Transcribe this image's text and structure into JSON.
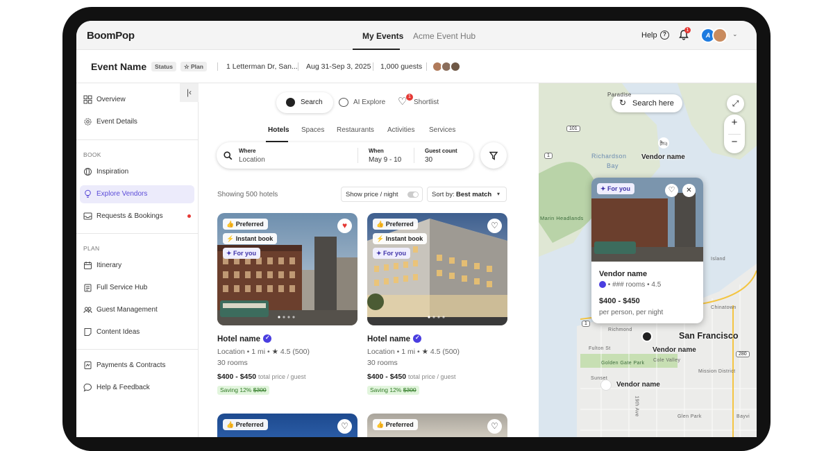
{
  "app": {
    "logo": "BoomPop"
  },
  "topnav": {
    "tabs": [
      {
        "label": "My Events"
      },
      {
        "label": "Acme Event Hub"
      }
    ],
    "help": "Help",
    "notification_count": "1"
  },
  "event": {
    "name": "Event Name",
    "status": "Status",
    "plan": "Plan",
    "address": "1 Letterman Dr, San...",
    "dates": "Aug 31-Sep 3, 2025",
    "guests": "1,000 guests"
  },
  "sidebar": {
    "top_items": [
      {
        "label": "Overview",
        "icon": "grid-icon"
      },
      {
        "label": "Event Details",
        "icon": "gear-icon"
      }
    ],
    "book_label": "BOOK",
    "book_items": [
      {
        "label": "Inspiration",
        "icon": "compass-icon"
      },
      {
        "label": "Explore Vendors",
        "icon": "lightbulb-icon"
      },
      {
        "label": "Requests & Bookings",
        "icon": "inbox-icon"
      }
    ],
    "plan_label": "PLAN",
    "plan_items": [
      {
        "label": "Itinerary",
        "icon": "calendar-icon"
      },
      {
        "label": "Full Service Hub",
        "icon": "clipboard-icon"
      },
      {
        "label": "Guest Management",
        "icon": "people-icon"
      },
      {
        "label": "Content Ideas",
        "icon": "note-icon"
      }
    ],
    "bottom_items": [
      {
        "label": "Payments & Contracts",
        "icon": "contract-icon"
      },
      {
        "label": "Help & Feedback",
        "icon": "chat-icon"
      }
    ]
  },
  "modes": {
    "search": "Search",
    "ai_explore": "AI Explore",
    "shortlist": "Shortlist",
    "shortlist_count": "1"
  },
  "categories": [
    "Hotels",
    "Spaces",
    "Restaurants",
    "Activities",
    "Services"
  ],
  "search": {
    "where_label": "Where",
    "where_value": "Location",
    "when_label": "When",
    "when_value": "May 9 - 10",
    "guest_label": "Guest count",
    "guest_value": "30"
  },
  "results": {
    "showing": "Showing 500 hotels",
    "toggle_label": "Show price / night",
    "sort_prefix": "Sort by:",
    "sort_value": "Best match"
  },
  "cards": [
    {
      "tags": [
        "Preferred",
        "Instant book",
        "For you"
      ],
      "favorited": true,
      "title": "Hotel name",
      "location": "Location",
      "distance": "1 mi",
      "rating": "4.5 (500)",
      "rooms": "30 rooms",
      "price": "$400 - $450",
      "price_note": "total price / guest",
      "saving": "Saving 12%",
      "old_price": "$300"
    },
    {
      "tags": [
        "Preferred",
        "Instant book",
        "For you"
      ],
      "favorited": false,
      "title": "Hotel name",
      "location": "Location",
      "distance": "1 mi",
      "rating": "4.5 (500)",
      "rooms": "30 rooms",
      "price": "$400 - $450",
      "price_note": "total price / guest",
      "saving": "Saving 12%",
      "old_price": "$300"
    },
    {
      "tags": [
        "Preferred"
      ]
    },
    {
      "tags": [
        "Preferred"
      ]
    }
  ],
  "map": {
    "search_here": "Search here",
    "labels": [
      "Vendor name",
      "Vendor name",
      "Vendor name"
    ],
    "city": "San Francisco",
    "places": [
      "Richardson",
      "Bay",
      "Marin Headlands",
      "Golden Gate Park",
      "Fulton St",
      "Cole Valley",
      "Mission District",
      "Sunset",
      "Richmond",
      "Chinatown",
      "Glen Park",
      "Bayvi",
      "19th Ave",
      "Paradise",
      "Island"
    ],
    "routes": [
      "101",
      "1",
      "1",
      "280"
    ],
    "popup": {
      "tag": "For you",
      "name": "Vendor name",
      "detail": "### rooms • 4.5",
      "price": "$400 - $450",
      "price_note": "per person, per night"
    }
  },
  "colors": {
    "accent": "#5b4bd8",
    "alert": "#e53935",
    "saving_bg": "#e2f5dd"
  }
}
